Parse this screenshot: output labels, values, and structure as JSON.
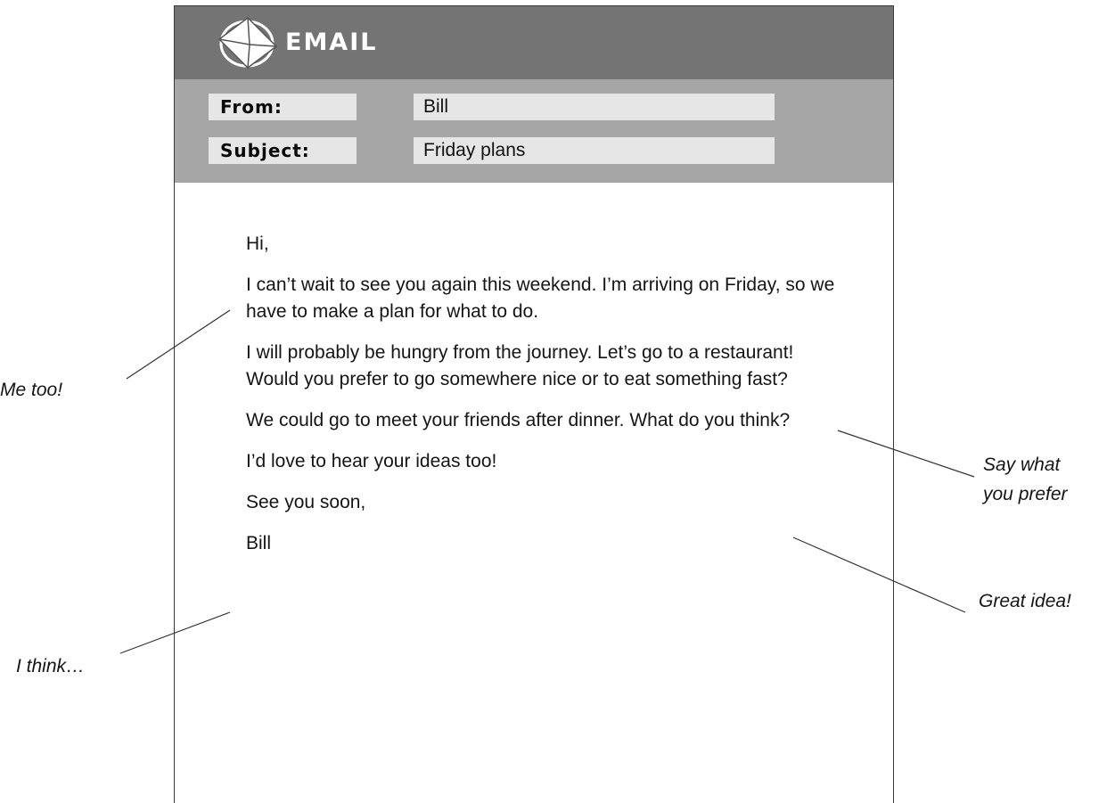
{
  "app": {
    "title": "EMAIL",
    "logo_icon": "envelope-logo-icon"
  },
  "header": {
    "from_label": "From:",
    "from_value": "Bill",
    "subject_label": "Subject:",
    "subject_value": "Friday plans"
  },
  "message": {
    "greeting": "Hi,",
    "paragraphs": [
      "I can’t wait to see you again this weekend. I’m arriving on Friday, so we have to make a plan for what to do.",
      "I will probably be hungry from the journey. Let’s go to a restaurant! Would you prefer to go somewhere nice or to eat something fast?",
      "We could go to meet your friends after dinner. What do you think?",
      "I’d love to hear your ideas too!"
    ],
    "closing": "See you soon,",
    "signature": "Bill"
  },
  "annotations": {
    "me_too": "Me too!",
    "i_think": "I think…",
    "say_what_line1": "Say what",
    "say_what_line2": "you prefer",
    "great_idea": "Great idea!"
  }
}
